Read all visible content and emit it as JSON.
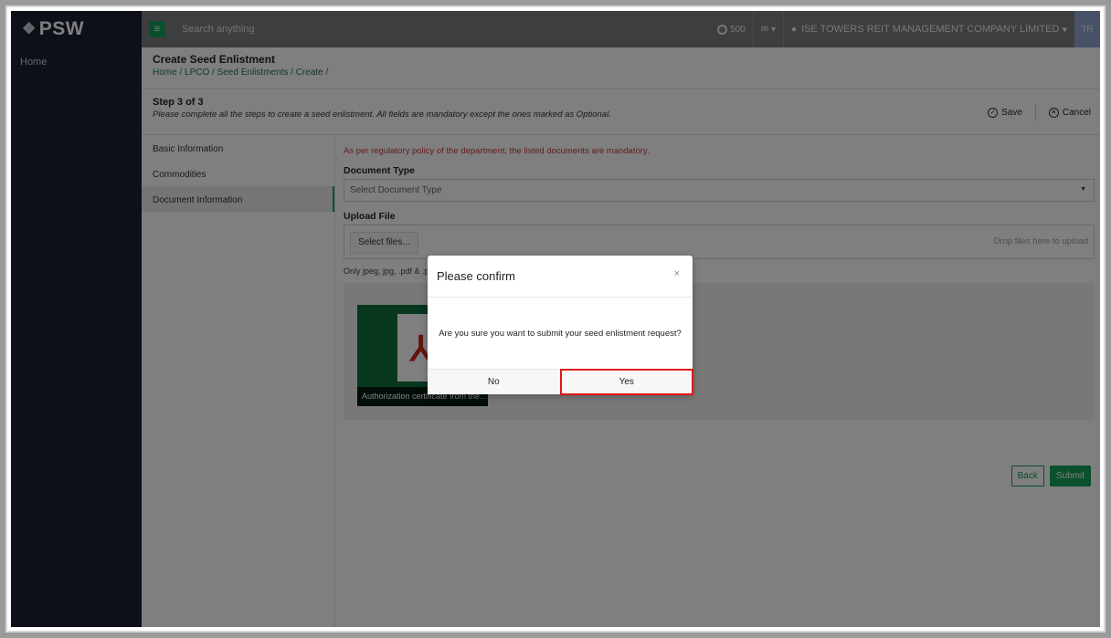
{
  "app": {
    "logo": "PSW",
    "logo_mark": "❖"
  },
  "sidebar": {
    "items": [
      {
        "label": "Home"
      }
    ]
  },
  "topbar": {
    "search_placeholder": "Search anything",
    "points": "500",
    "mail_caret": "▾",
    "user_name": "ISE TOWERS REIT MANAGEMENT COMPANY LIMITED",
    "user_caret": "▾",
    "avatar": "TR"
  },
  "page": {
    "title": "Create Seed Enlistment",
    "breadcrumb": "Home / LPCO / Seed Enlistments / Create /"
  },
  "step": {
    "title": "Step 3 of 3",
    "description": "Please complete all the steps to create a seed enlistment. All fields are mandatory except the ones marked as Optional.",
    "save_label": "Save",
    "cancel_label": "Cancel"
  },
  "steps_nav": [
    {
      "label": "Basic Information"
    },
    {
      "label": "Commodities"
    },
    {
      "label": "Document Information"
    }
  ],
  "form": {
    "note": "As per regulatory policy of the department, the listed documents are mandatory.",
    "doc_type_label": "Document Type",
    "doc_type_placeholder": "Select Document Type",
    "upload_label": "Upload File",
    "select_files_label": "Select files...",
    "drop_label": "Drop files here to upload",
    "only_types": "Only jpeg, jpg, .pdf & .png",
    "doc_caption": "Authorization certificate from the...",
    "back_label": "Back",
    "submit_label": "Submit"
  },
  "modal": {
    "title": "Please confirm",
    "close": "×",
    "message": "Are you sure you want to submit your seed enlistment request?",
    "no_label": "No",
    "yes_label": "Yes"
  },
  "colors": {
    "accent": "#14a05a",
    "sidebar": "#1a2133",
    "highlight": "#e01818",
    "note": "#c53a3a"
  }
}
